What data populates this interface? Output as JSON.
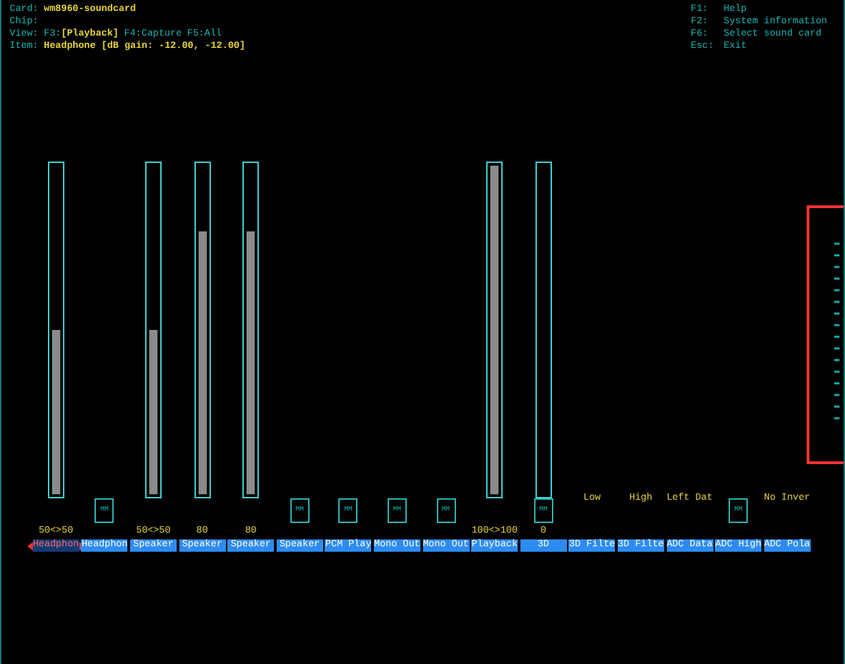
{
  "header": {
    "card": {
      "label": "Card:",
      "value": "wm8960-soundcard"
    },
    "chip": {
      "label": "Chip:"
    },
    "view": {
      "label": "View:",
      "options": [
        {
          "key": "F3:",
          "text": "[Playback]",
          "selected": true
        },
        {
          "key": "F4:",
          "text": "Capture",
          "selected": false
        },
        {
          "key": "F5:",
          "text": "All",
          "selected": false
        }
      ]
    },
    "item": {
      "label": "Item:",
      "value": "Headphone [dB gain: -12.00, -12.00]"
    }
  },
  "help": [
    {
      "key": "F1:",
      "text": "Help"
    },
    {
      "key": "F2:",
      "text": "System information"
    },
    {
      "key": "F6:",
      "text": "Select sound card"
    },
    {
      "key": "Esc:",
      "text": "Exit"
    }
  ],
  "controls": [
    {
      "kind": "volume",
      "label": "Headphon",
      "selected": true,
      "level": 0.5,
      "value": "50<>50"
    },
    {
      "kind": "switch",
      "label": "Headphon",
      "selected": false,
      "mute": "MM",
      "muted": true
    },
    {
      "kind": "volume",
      "label": "Speaker",
      "selected": false,
      "level": 0.5,
      "value": "50<>50"
    },
    {
      "kind": "volume",
      "label": "Speaker",
      "selected": false,
      "level": 0.8,
      "value": "80"
    },
    {
      "kind": "volume",
      "label": "Speaker",
      "selected": false,
      "level": 0.8,
      "value": "80"
    },
    {
      "kind": "switch",
      "label": "Speaker",
      "selected": false,
      "mute": "MM",
      "muted": true
    },
    {
      "kind": "switch",
      "label": "PCM Play",
      "selected": false,
      "mute": "MM",
      "muted": true
    },
    {
      "kind": "switch",
      "label": "Mono Out",
      "selected": false,
      "mute": "MM",
      "muted": true
    },
    {
      "kind": "switch",
      "label": "Mono Out",
      "selected": false,
      "mute": "MM",
      "muted": true
    },
    {
      "kind": "volume",
      "label": "Playback",
      "selected": false,
      "level": 1,
      "value": "100<>100"
    },
    {
      "kind": "volume_switch",
      "label": "3D",
      "selected": false,
      "level": 0,
      "value": "0",
      "mute": "MM",
      "muted": true
    },
    {
      "kind": "enum",
      "label": "3D Filte",
      "selected": false,
      "value": "Low"
    },
    {
      "kind": "enum",
      "label": "3D Filte",
      "selected": false,
      "value": "High"
    },
    {
      "kind": "enum",
      "label": "ADC Data",
      "selected": false,
      "value": "Left Dat"
    },
    {
      "kind": "switch",
      "label": "ADC High",
      "selected": false,
      "mute": "MM",
      "muted": true
    },
    {
      "kind": "enum",
      "label": "ADC Pola",
      "selected": false,
      "value": "No Inver"
    }
  ]
}
